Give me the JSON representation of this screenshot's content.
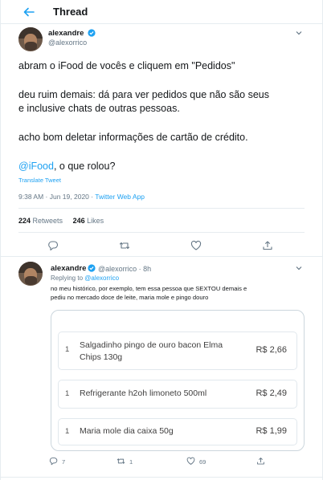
{
  "header": {
    "title": "Thread"
  },
  "main_tweet": {
    "name": "alexandre",
    "handle": "@alexorrico",
    "paragraphs": [
      "abram o iFood de vocês e cliquem em \"Pedidos\"",
      "deu ruim demais: dá para ver pedidos que não são seus",
      "e inclusive chats de outras pessoas.",
      "acho bom deletar informações de cartão de crédito."
    ],
    "mention": "@iFood",
    "mention_suffix": ", o que rolou?",
    "translate": "Translate Tweet",
    "timestamp": "9:38 AM · Jun 19, 2020 · ",
    "source": "Twitter Web App",
    "retweets_count": "224",
    "retweets_label": " Retweets",
    "likes_count": "246",
    "likes_label": " Likes"
  },
  "reply_tweet": {
    "name": "alexandre",
    "handle_time": "@alexorrico · 8h",
    "replying_prefix": "Replying to ",
    "replying_to": "@alexorrico",
    "text_line1": "no meu histórico, por exemplo, tem essa pessoa que SEXTOU demais e",
    "text_line2": "pediu no mercado doce de leite, maria mole e pingo douro",
    "order_items": [
      {
        "qty": "1",
        "line1": "Salgadinho pingo de ouro bacon Elma",
        "line2": "Chips 130g",
        "price": "R$ 2,66"
      },
      {
        "qty": "1",
        "line1": "Refrigerante h2oh limoneto 500ml",
        "line2": "",
        "price": "R$ 2,49"
      },
      {
        "qty": "1",
        "line1": "Maria mole dia caixa 50g",
        "line2": "",
        "price": "R$ 1,99"
      }
    ],
    "reply_count": "7",
    "retweet_count": "1",
    "like_count": "69"
  },
  "colors": {
    "accent": "#1da1f2",
    "text": "#14171a",
    "muted": "#657786",
    "border": "#e6ecf0"
  },
  "icons": [
    "back-arrow-icon",
    "verified-badge-icon",
    "chevron-down-icon",
    "reply-icon",
    "retweet-icon",
    "like-icon",
    "share-icon"
  ]
}
